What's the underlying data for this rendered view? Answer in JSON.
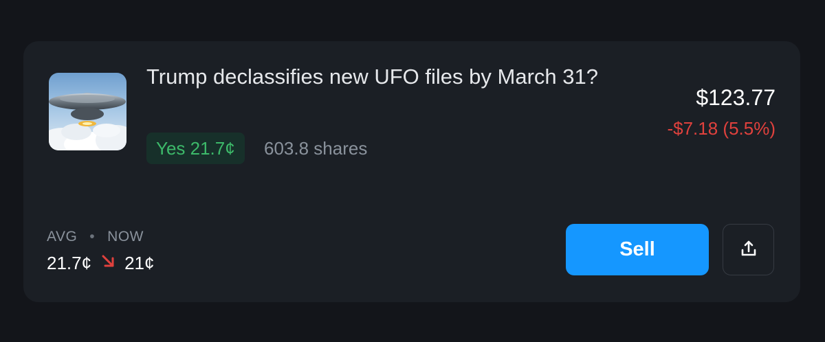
{
  "position": {
    "title": "Trump declassifies new UFO files by March 31?",
    "outcome_badge": "Yes 21.7¢",
    "shares": "603.8 shares",
    "value": "$123.77",
    "change": "-$7.18 (5.5%)",
    "thumbnail": "ufo-image",
    "avg_label": "AVG",
    "separator": "•",
    "now_label": "NOW",
    "avg_value": "21.7¢",
    "now_value": "21¢",
    "trend_icon": "arrow-down-right-icon"
  },
  "actions": {
    "sell_label": "Sell",
    "share_icon": "share-upload-icon"
  },
  "colors": {
    "background": "#13151a",
    "card": "#1b1f25",
    "positive": "#3dba6a",
    "negative": "#e0413d",
    "accent": "#1597ff"
  }
}
